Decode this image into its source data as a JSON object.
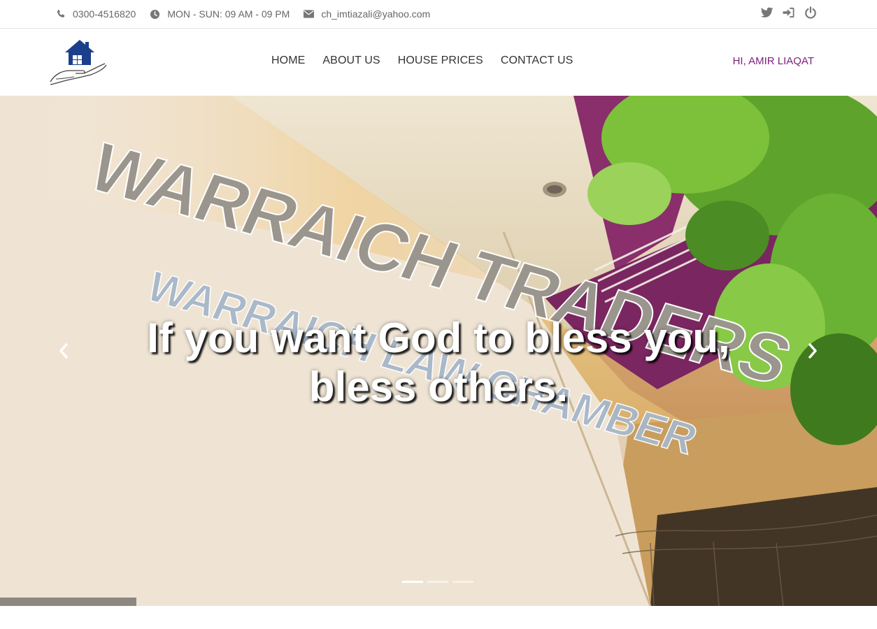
{
  "topbar": {
    "phone": "0300-4516820",
    "hours": "MON - SUN: 09 AM - 09 PM",
    "email": "ch_imtiazali@yahoo.com",
    "icons": [
      "phone-icon",
      "clock-icon",
      "envelope-icon",
      "twitter-icon",
      "sign-in-icon",
      "power-icon"
    ],
    "icon_color": "#777777"
  },
  "header": {
    "logo_icon": "house-in-hand-logo",
    "nav": [
      {
        "label": "HOME"
      },
      {
        "label": "ABOUT US"
      },
      {
        "label": "HOUSE PRICES"
      },
      {
        "label": "CONTACT US"
      }
    ],
    "greeting": "HI, AMIR LIAQAT",
    "greeting_color": "#7d1f7c"
  },
  "hero": {
    "caption_line1": "If you want God to bless you,",
    "caption_line2": "bless others.",
    "background_sign_text_1": "WARRAICH TRADERS",
    "background_sign_text_2": "WARRAICH LAW CHAMBER",
    "slide_count": 3,
    "active_slide": 1
  }
}
